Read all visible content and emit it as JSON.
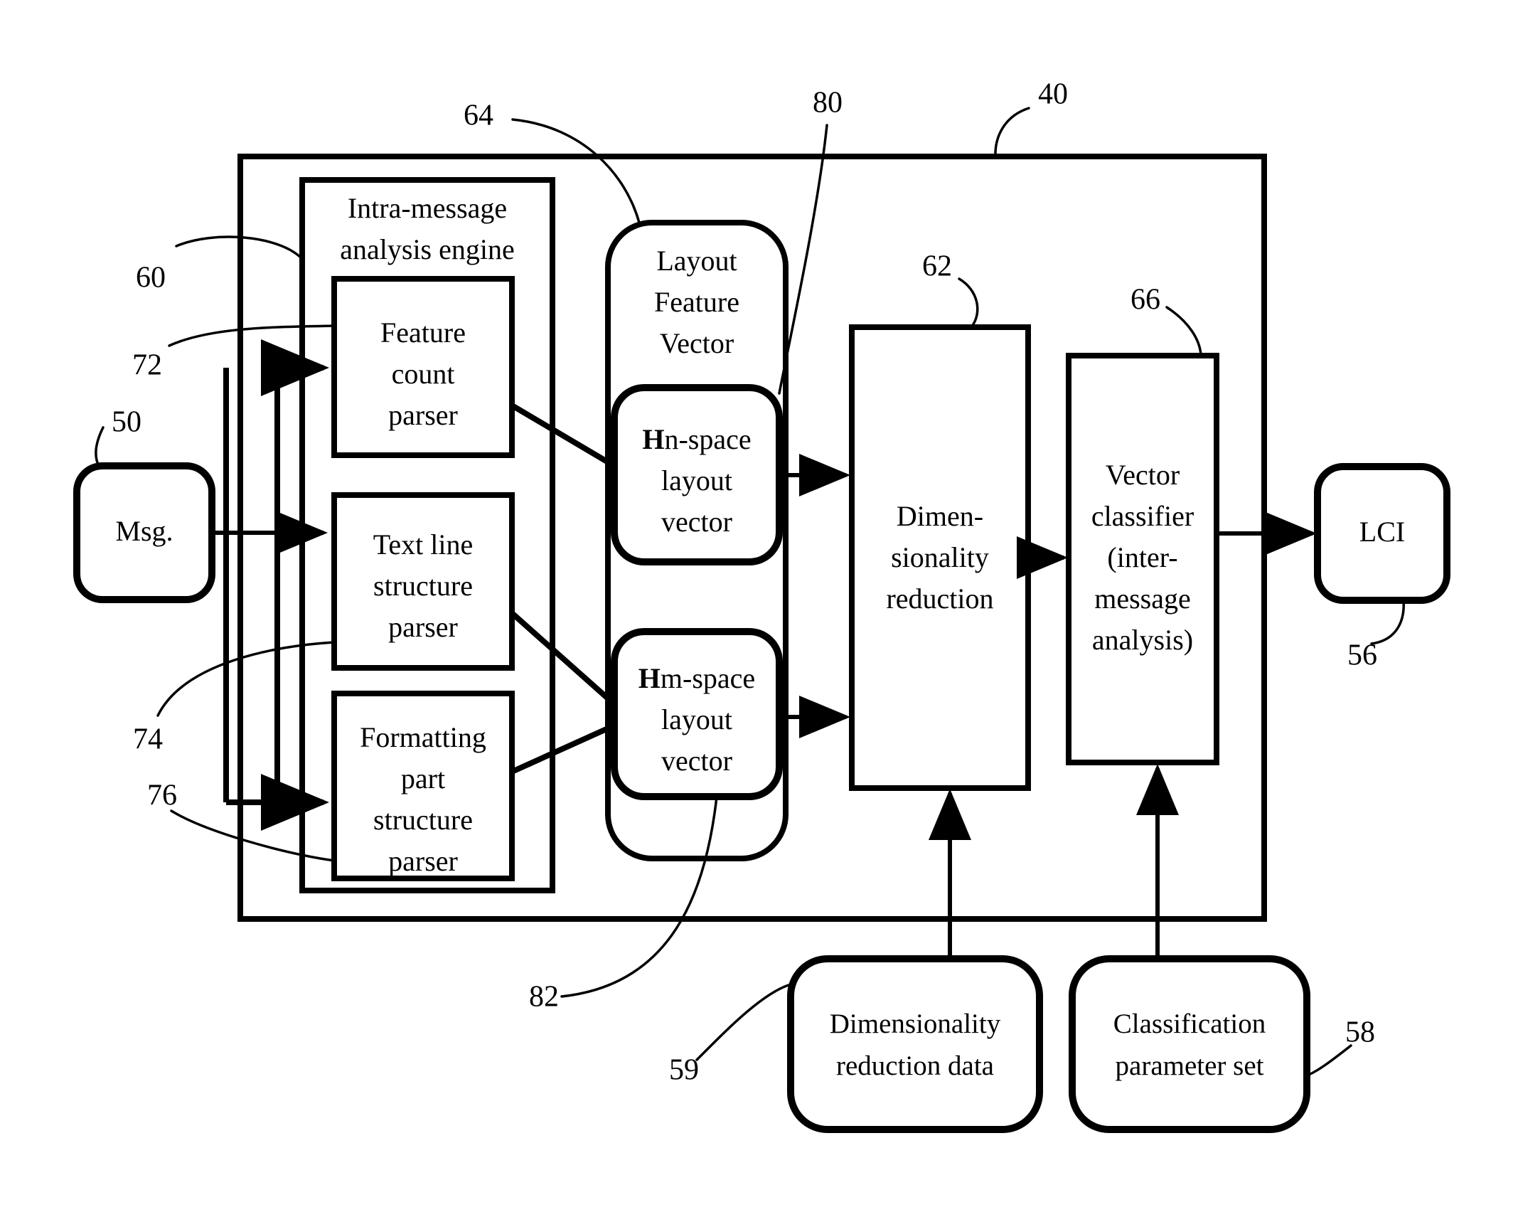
{
  "figure": {
    "type": "patent-block-diagram",
    "background_color": "#ffffff",
    "line_color": "#000000"
  },
  "blocks": {
    "msg": {
      "label": "Msg.",
      "ref": "50"
    },
    "outer_system": {
      "ref": "40"
    },
    "intra_message_engine": {
      "title_line1": "Intra-message",
      "title_line2": "analysis engine",
      "ref": "60"
    },
    "feature_count_parser": {
      "line1": "Feature",
      "line2": "count",
      "line3": "parser",
      "ref": "72"
    },
    "text_line_structure_parser": {
      "line1": "Text line",
      "line2": "structure",
      "line3": "parser",
      "ref": "74"
    },
    "formatting_part_structure_parser": {
      "line1": "Formatting",
      "line2": "part",
      "line3": "structure",
      "line4": "parser",
      "ref": "76"
    },
    "layout_feature_vector": {
      "line1": "Layout",
      "line2": "Feature",
      "line3": "Vector",
      "ref": "64"
    },
    "hn_space_vector": {
      "prefix": "H",
      "line1_rest": "n-space",
      "line2": "layout",
      "line3": "vector",
      "ref": "80"
    },
    "hm_space_vector": {
      "prefix": "H",
      "line1_rest": "m-space",
      "line2": "layout",
      "line3": "vector",
      "ref": "82"
    },
    "dimensionality_reduction": {
      "line1": "Dimen-",
      "line2": "sionality",
      "line3": "reduction",
      "ref": "62"
    },
    "vector_classifier": {
      "line1": "Vector",
      "line2": "classifier",
      "line3": "(inter-",
      "line4": "message",
      "line5": "analysis)",
      "ref": "66"
    },
    "lci": {
      "label": "LCI",
      "ref": "56"
    },
    "dimensionality_reduction_data": {
      "line1": "Dimensionality",
      "line2": "reduction data",
      "ref": "59"
    },
    "classification_parameter_set": {
      "line1": "Classification",
      "line2": "parameter set",
      "ref": "58"
    }
  },
  "reference_numerals": {
    "n40": "40",
    "n50": "50",
    "n56": "56",
    "n58": "58",
    "n59": "59",
    "n60": "60",
    "n62": "62",
    "n64": "64",
    "n66": "66",
    "n72": "72",
    "n74": "74",
    "n76": "76",
    "n80": "80",
    "n82": "82"
  }
}
